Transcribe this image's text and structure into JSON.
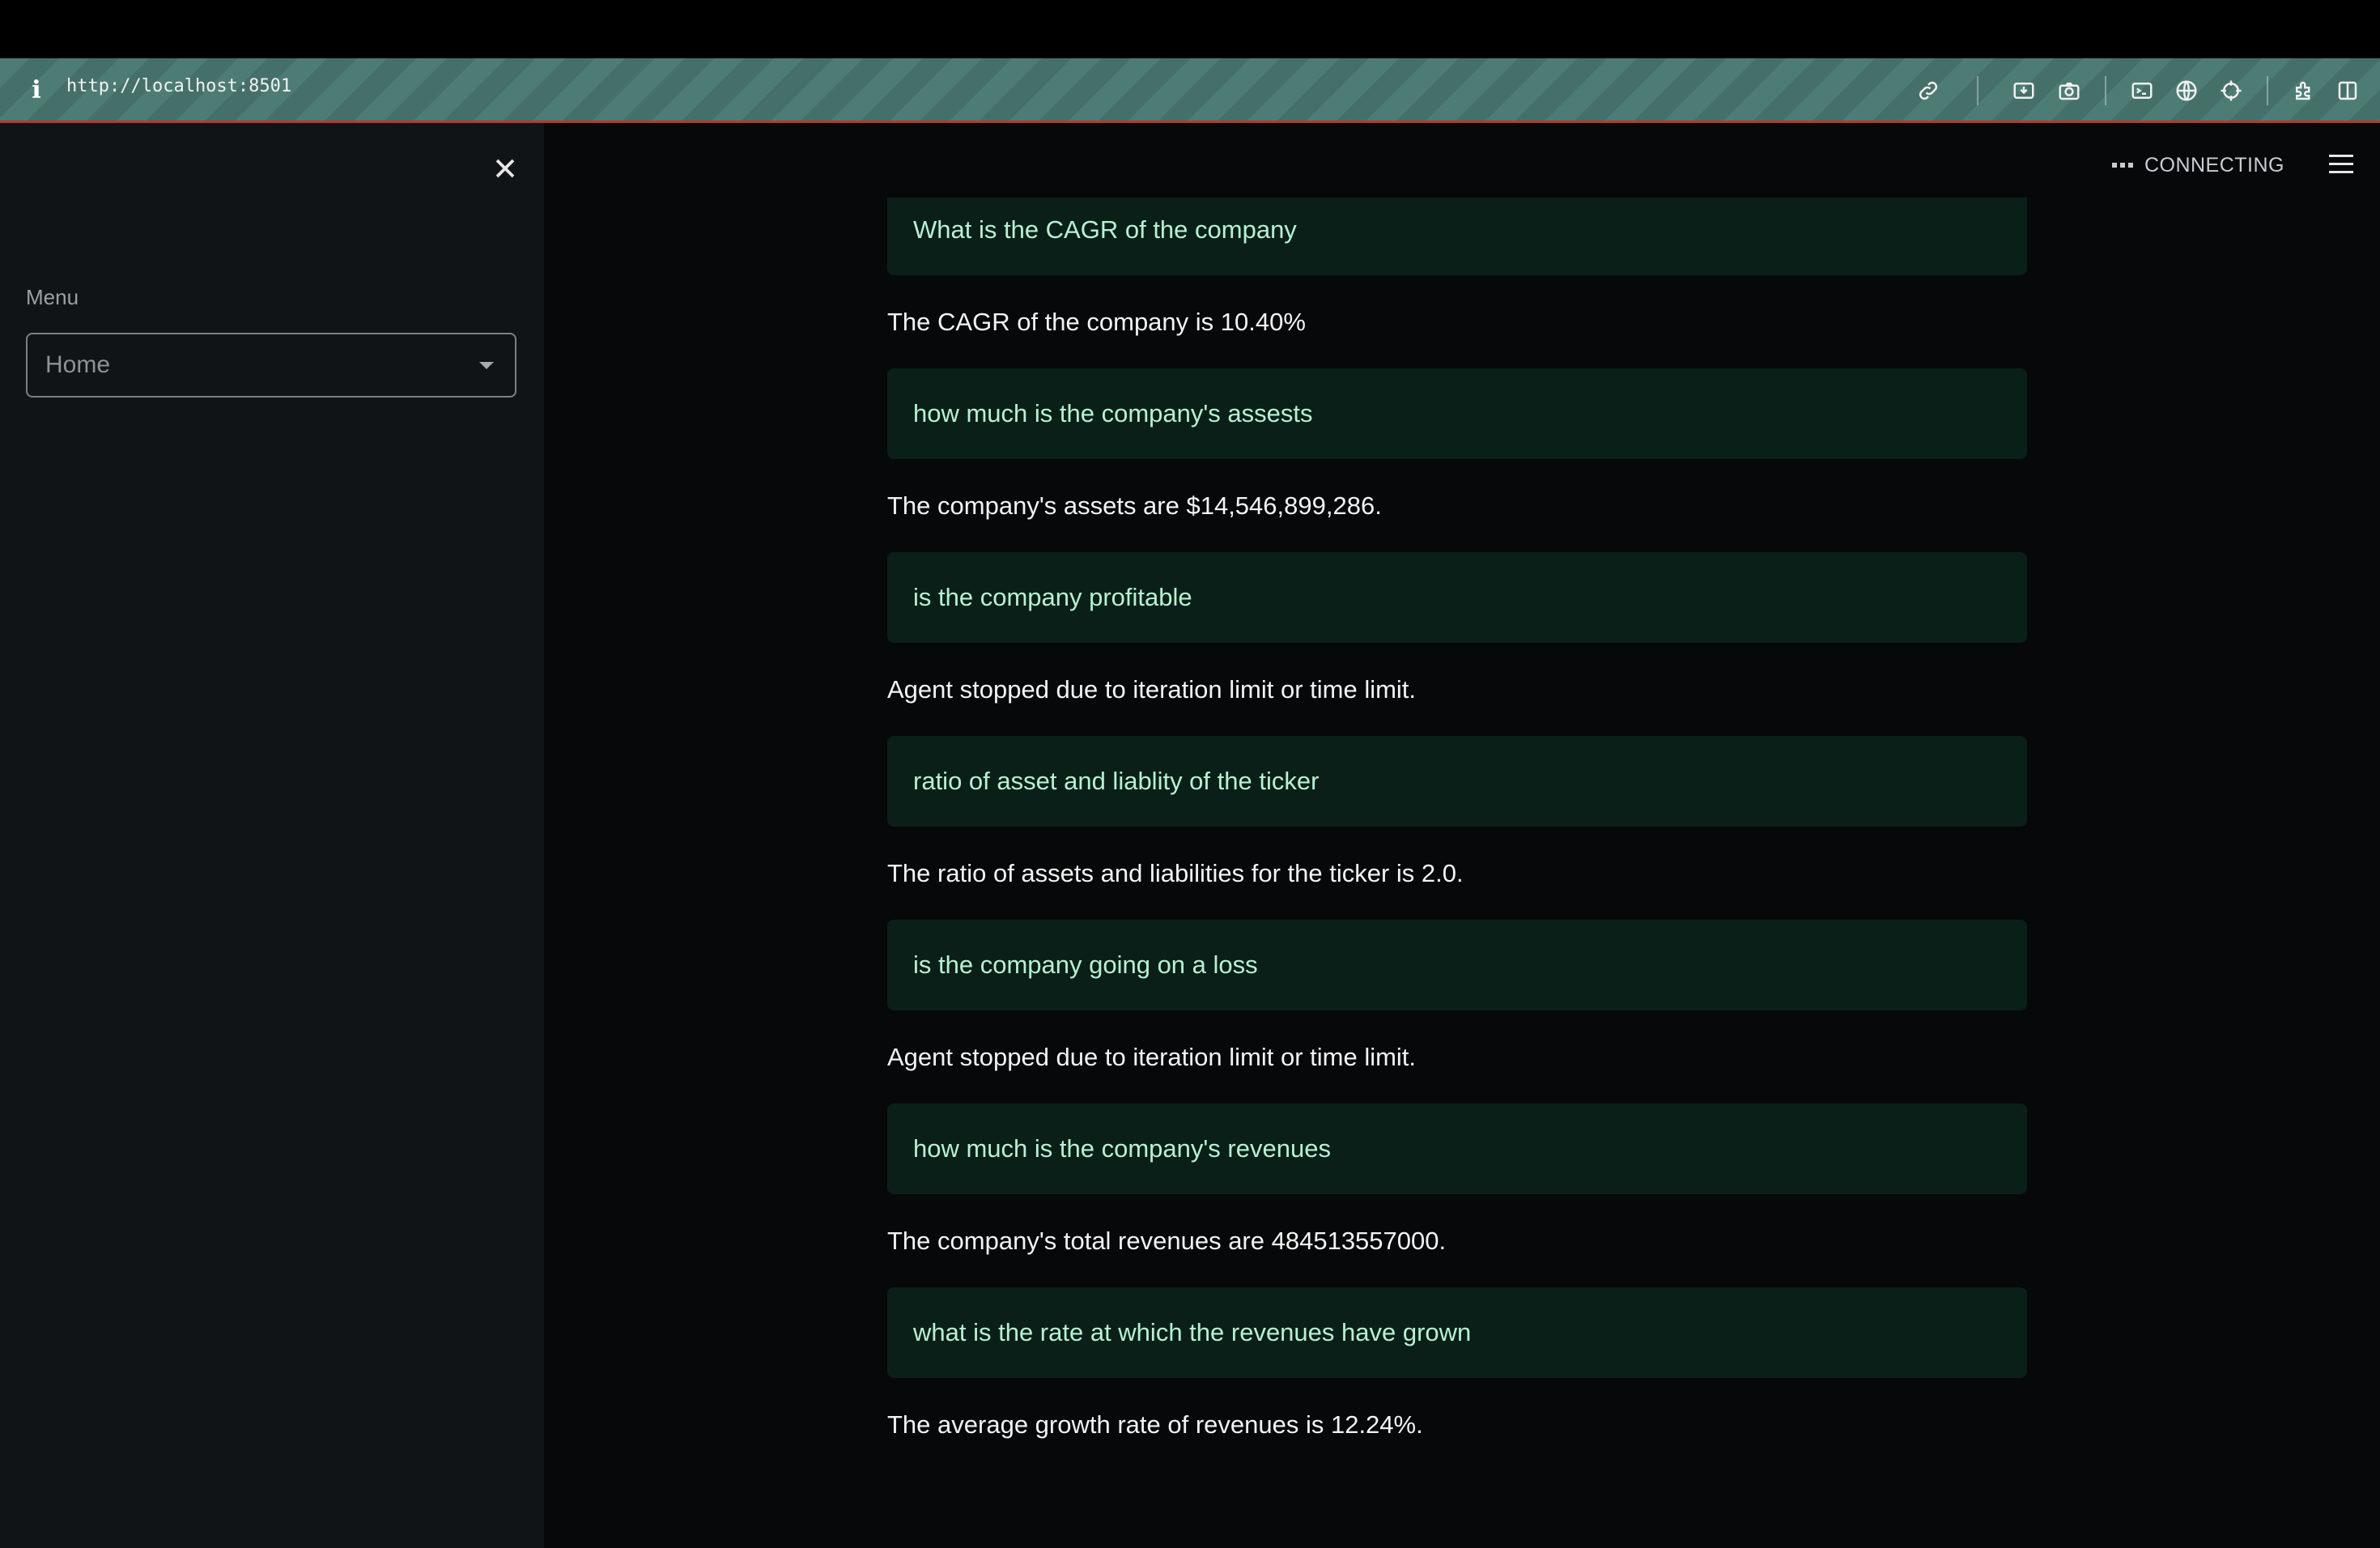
{
  "browser": {
    "url": "http://localhost:8501",
    "toolbar_icons": [
      "link-icon",
      "download-icon",
      "camera-icon",
      "terminal-icon",
      "globe-icon",
      "crosshair-icon",
      "extensions-icon",
      "split-view-icon"
    ]
  },
  "sidebar": {
    "menu_label": "Menu",
    "select": {
      "value": "Home"
    }
  },
  "header": {
    "status": "CONNECTING"
  },
  "chat": {
    "messages": [
      {
        "question": "What is the CAGR of the company",
        "answer": "The CAGR of the company is 10.40%"
      },
      {
        "question": "how much is the company's assests",
        "answer": "The company's assets are $14,546,899,286."
      },
      {
        "question": "is the company profitable",
        "answer": "Agent stopped due to iteration limit or time limit."
      },
      {
        "question": "ratio of asset and liablity of the ticker",
        "answer": "The ratio of assets and liabilities for the ticker is 2.0."
      },
      {
        "question": "is the company going on a loss",
        "answer": "Agent stopped due to iteration limit or time limit."
      },
      {
        "question": "how much is the company's revenues",
        "answer": "The company's total revenues are 484513557000."
      },
      {
        "question": "what is the rate at which the revenues have grown",
        "answer": "The average growth rate of revenues is 12.24%."
      }
    ]
  },
  "colors": {
    "accent_bar": "#b8362b",
    "question_bg": "#0b1f19",
    "question_text": "#b6f2d2",
    "sidebar_bg": "#111416",
    "main_bg": "#060809"
  }
}
